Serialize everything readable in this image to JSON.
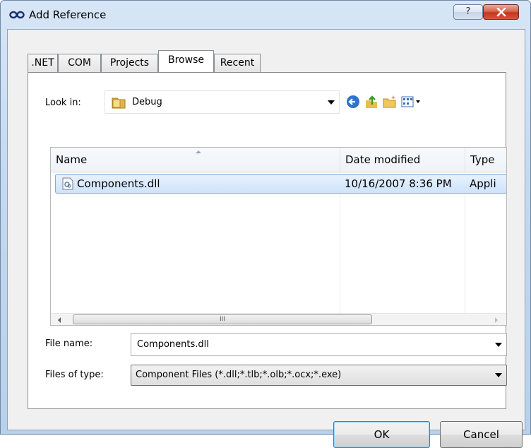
{
  "window": {
    "title": "Add Reference",
    "help_glyph": "?"
  },
  "tabs": [
    ".NET",
    "COM",
    "Projects",
    "Browse",
    "Recent"
  ],
  "active_tab": "Browse",
  "look_in": {
    "label": "Look in:",
    "value": "Debug"
  },
  "toolbar_icons": [
    "back-icon",
    "up-folder-icon",
    "new-folder-icon",
    "view-menu-icon"
  ],
  "file_list": {
    "columns": [
      "Name",
      "Date modified",
      "Type"
    ],
    "rows": [
      {
        "name": "Components.dll",
        "date_modified": "10/16/2007 8:36 PM",
        "type": "Appli"
      }
    ],
    "scroll_grip": "III"
  },
  "file_name": {
    "label": "File name:",
    "value": "Components.dll"
  },
  "files_of_type": {
    "label": "Files of type:",
    "value": "Component Files (*.dll;*.tlb;*.olb;*.ocx;*.exe)"
  },
  "buttons": {
    "ok": "OK",
    "cancel": "Cancel"
  },
  "colors": {
    "selection": "#cfe3fb",
    "title_bar": "#c5d9ef",
    "close_button": "#c4361c"
  }
}
